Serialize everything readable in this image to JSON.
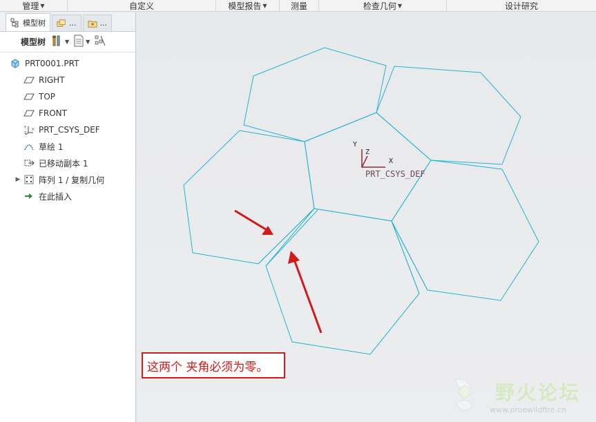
{
  "ribbon": {
    "groups": [
      {
        "label": "管理",
        "dropdown": true
      },
      {
        "label": "自定义",
        "dropdown": false
      },
      {
        "label": "模型报告",
        "dropdown": true
      },
      {
        "label": "测量",
        "dropdown": false
      },
      {
        "label": "检查几何",
        "dropdown": true
      },
      {
        "label": "设计研究",
        "dropdown": false
      }
    ]
  },
  "panel": {
    "tabs": [
      {
        "label": "模型树",
        "icon": "model-tree-icon"
      },
      {
        "label": "...",
        "icon": "layers-icon"
      },
      {
        "label": "...",
        "icon": "favorites-folder-icon"
      }
    ],
    "toolbar": {
      "label": "模型树"
    },
    "tree": [
      {
        "label": "PRT0001.PRT",
        "icon": "part-icon"
      },
      {
        "label": "RIGHT",
        "icon": "datum-plane-icon"
      },
      {
        "label": "TOP",
        "icon": "datum-plane-icon"
      },
      {
        "label": "FRONT",
        "icon": "datum-plane-icon"
      },
      {
        "label": "PRT_CSYS_DEF",
        "icon": "csys-icon"
      },
      {
        "label": "草绘 1",
        "icon": "sketch-icon"
      },
      {
        "label": "已移动副本 1",
        "icon": "moved-copy-icon"
      },
      {
        "label": "阵列 1 / 复制几何",
        "icon": "pattern-icon"
      },
      {
        "label": "在此插入",
        "icon": "insert-here-arrow-icon"
      }
    ]
  },
  "canvas": {
    "csys_label": "PRT_CSYS_DEF",
    "axis_x": "X",
    "axis_y": "Y",
    "axis_z": "Z",
    "edge_color": "#1fb3d6",
    "arrow_color": "#d11a1a"
  },
  "annotation": {
    "text": "这两个  夹角必须为零。"
  },
  "watermark": {
    "title": "野火论坛",
    "url": "www.proewildfire.cn"
  }
}
